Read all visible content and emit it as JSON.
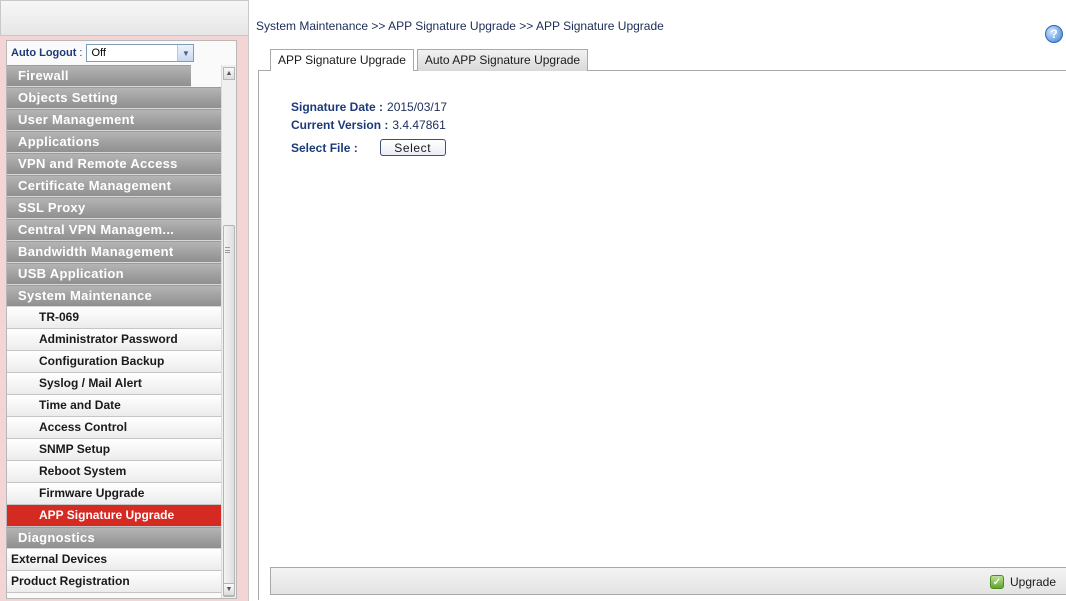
{
  "sidebar": {
    "auto_logout": {
      "label": "Auto Logout",
      "separator": ":",
      "value": "Off"
    },
    "groups_top": [
      {
        "label": "Firewall"
      },
      {
        "label": "Objects Setting"
      },
      {
        "label": "User Management"
      },
      {
        "label": "Applications"
      },
      {
        "label": "VPN and Remote Access"
      },
      {
        "label": "Certificate Management"
      },
      {
        "label": "SSL Proxy"
      },
      {
        "label": "Central VPN Managem..."
      },
      {
        "label": "Bandwidth Management"
      },
      {
        "label": "USB Application"
      },
      {
        "label": "System Maintenance"
      }
    ],
    "sub_items": [
      {
        "label": "TR-069"
      },
      {
        "label": "Administrator Password"
      },
      {
        "label": "Configuration Backup"
      },
      {
        "label": "Syslog / Mail Alert"
      },
      {
        "label": "Time and Date"
      },
      {
        "label": "Access Control"
      },
      {
        "label": "SNMP Setup"
      },
      {
        "label": "Reboot System"
      },
      {
        "label": "Firmware Upgrade"
      },
      {
        "label": "APP Signature Upgrade"
      }
    ],
    "active_item": "APP Signature Upgrade",
    "groups_bottom": [
      {
        "label": "Diagnostics"
      }
    ],
    "plain_items": [
      {
        "label": "External Devices"
      },
      {
        "label": "Product Registration"
      }
    ]
  },
  "header": {
    "breadcrumb": "System Maintenance >> APP Signature Upgrade >> APP Signature Upgrade",
    "help_icon": "help-icon"
  },
  "tabs": [
    {
      "label": "APP Signature Upgrade",
      "active": true
    },
    {
      "label": "Auto APP Signature Upgrade",
      "active": false
    }
  ],
  "form": {
    "signature_date_label": "Signature Date :",
    "signature_date_value": "2015/03/17",
    "current_version_label": "Current Version :",
    "current_version_value": "3.4.47861",
    "select_file_label": "Select File :",
    "select_button_label": "Select"
  },
  "footer": {
    "upgrade_label": "Upgrade",
    "upgrade_icon": "upgrade-icon"
  },
  "colors": {
    "active_menu": "#d42a22",
    "menu_group": "#a0a0a0",
    "sidebar_bg": "#f3d5d5",
    "text_blue": "#1b3a7a"
  }
}
